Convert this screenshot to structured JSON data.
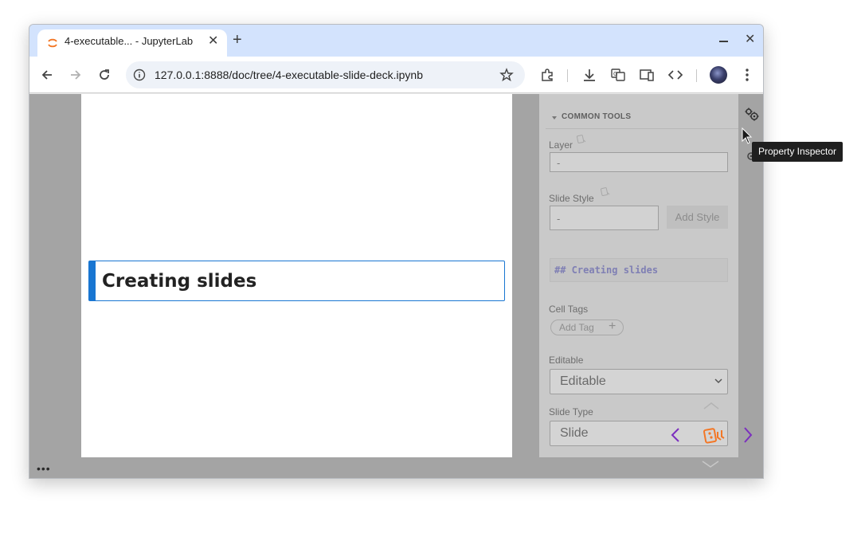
{
  "browser": {
    "tab_title": "4-executable... - JupyterLab",
    "url": "127.0.0.1:8888/doc/tree/4-executable-slide-deck.ipynb"
  },
  "slide": {
    "heading": "Creating slides",
    "menu_label": "•••"
  },
  "inspector": {
    "section_title": "COMMON TOOLS",
    "layer_label": "Layer",
    "layer_value": "-",
    "slide_style_label": "Slide Style",
    "slide_style_value": "-",
    "add_style_button": "Add Style",
    "markdown_preview": "## Creating slides",
    "cell_tags_label": "Cell Tags",
    "add_tag_label": "Add Tag",
    "editable_label": "Editable",
    "editable_value": "Editable",
    "slide_type_label": "Slide Type",
    "slide_type_value": "Slide"
  },
  "tooltip": "Property Inspector",
  "colors": {
    "accent": "#1976d2",
    "tabstrip": "#d3e3fd",
    "jupyter_orange": "#f37726",
    "nav_purple": "#7b2fbe"
  }
}
